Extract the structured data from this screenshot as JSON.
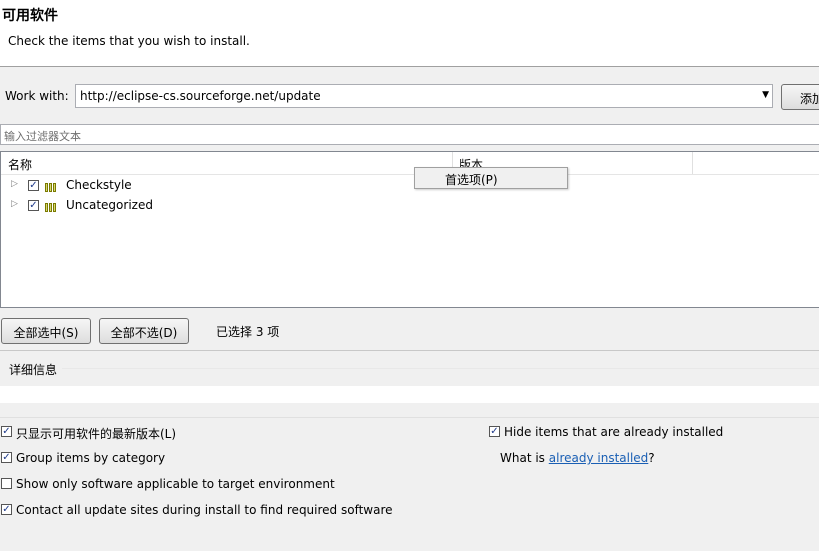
{
  "header": {
    "title": "可用软件",
    "subtitle": "Check the items that you wish to install."
  },
  "work_with": {
    "label": "Work with:",
    "value": "http://eclipse-cs.sourceforge.net/update",
    "add_label": "添加"
  },
  "filter": {
    "placeholder": "输入过滤器文本"
  },
  "tree": {
    "columns": [
      "名称",
      "版本"
    ],
    "rows": [
      {
        "label": "Checkstyle",
        "checked": true
      },
      {
        "label": "Uncategorized",
        "checked": true
      }
    ]
  },
  "context_menu": {
    "item": "首选项(P)"
  },
  "buttons": {
    "select_all": "全部选中(S)",
    "deselect_all": "全部不选(D)",
    "selected_count": "已选择 3 项"
  },
  "details": {
    "label": "详细信息"
  },
  "options": {
    "latest_versions": {
      "label": "只显示可用软件的最新版本(L)",
      "checked": true
    },
    "group_by_category": {
      "label": "Group items by category",
      "checked": true
    },
    "applicable_only": {
      "label": "Show only software applicable to target environment",
      "checked": false
    },
    "contact_all_sites": {
      "label": "Contact all update sites during install to find required software",
      "checked": true
    },
    "hide_installed": {
      "label": "Hide items that are already installed",
      "checked": true
    },
    "what_is_prefix": "What is ",
    "already_installed_link": "already installed",
    "what_is_suffix": "?"
  },
  "icons": {
    "expander": "expand-triangle-icon",
    "package": "feature-package-icon",
    "combo_arrow": "dropdown-arrow-icon",
    "checkmark": "checkmark-icon"
  }
}
